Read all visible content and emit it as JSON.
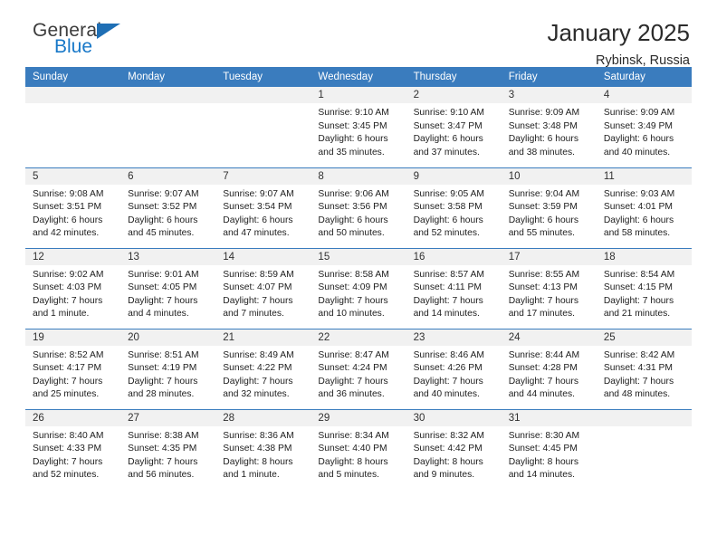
{
  "brand": {
    "name_top": "General",
    "name_bottom": "Blue",
    "triangle_color": "#1f6fb5",
    "blue_color": "#1878c8"
  },
  "header": {
    "title": "January 2025",
    "location": "Rybinsk, Russia"
  },
  "theme": {
    "header_row_bg": "#3a7cbe",
    "daynum_bg": "#f1f1f1",
    "row_rule": "#3a7cbe"
  },
  "calendar": {
    "weekday_headers": [
      "Sunday",
      "Monday",
      "Tuesday",
      "Wednesday",
      "Thursday",
      "Friday",
      "Saturday"
    ],
    "weeks": [
      [
        {
          "day": "",
          "empty": true
        },
        {
          "day": "",
          "empty": true
        },
        {
          "day": "",
          "empty": true
        },
        {
          "day": "1",
          "sunrise": "Sunrise: 9:10 AM",
          "sunset": "Sunset: 3:45 PM",
          "daylight1": "Daylight: 6 hours",
          "daylight2": "and 35 minutes."
        },
        {
          "day": "2",
          "sunrise": "Sunrise: 9:10 AM",
          "sunset": "Sunset: 3:47 PM",
          "daylight1": "Daylight: 6 hours",
          "daylight2": "and 37 minutes."
        },
        {
          "day": "3",
          "sunrise": "Sunrise: 9:09 AM",
          "sunset": "Sunset: 3:48 PM",
          "daylight1": "Daylight: 6 hours",
          "daylight2": "and 38 minutes."
        },
        {
          "day": "4",
          "sunrise": "Sunrise: 9:09 AM",
          "sunset": "Sunset: 3:49 PM",
          "daylight1": "Daylight: 6 hours",
          "daylight2": "and 40 minutes."
        }
      ],
      [
        {
          "day": "5",
          "sunrise": "Sunrise: 9:08 AM",
          "sunset": "Sunset: 3:51 PM",
          "daylight1": "Daylight: 6 hours",
          "daylight2": "and 42 minutes."
        },
        {
          "day": "6",
          "sunrise": "Sunrise: 9:07 AM",
          "sunset": "Sunset: 3:52 PM",
          "daylight1": "Daylight: 6 hours",
          "daylight2": "and 45 minutes."
        },
        {
          "day": "7",
          "sunrise": "Sunrise: 9:07 AM",
          "sunset": "Sunset: 3:54 PM",
          "daylight1": "Daylight: 6 hours",
          "daylight2": "and 47 minutes."
        },
        {
          "day": "8",
          "sunrise": "Sunrise: 9:06 AM",
          "sunset": "Sunset: 3:56 PM",
          "daylight1": "Daylight: 6 hours",
          "daylight2": "and 50 minutes."
        },
        {
          "day": "9",
          "sunrise": "Sunrise: 9:05 AM",
          "sunset": "Sunset: 3:58 PM",
          "daylight1": "Daylight: 6 hours",
          "daylight2": "and 52 minutes."
        },
        {
          "day": "10",
          "sunrise": "Sunrise: 9:04 AM",
          "sunset": "Sunset: 3:59 PM",
          "daylight1": "Daylight: 6 hours",
          "daylight2": "and 55 minutes."
        },
        {
          "day": "11",
          "sunrise": "Sunrise: 9:03 AM",
          "sunset": "Sunset: 4:01 PM",
          "daylight1": "Daylight: 6 hours",
          "daylight2": "and 58 minutes."
        }
      ],
      [
        {
          "day": "12",
          "sunrise": "Sunrise: 9:02 AM",
          "sunset": "Sunset: 4:03 PM",
          "daylight1": "Daylight: 7 hours",
          "daylight2": "and 1 minute."
        },
        {
          "day": "13",
          "sunrise": "Sunrise: 9:01 AM",
          "sunset": "Sunset: 4:05 PM",
          "daylight1": "Daylight: 7 hours",
          "daylight2": "and 4 minutes."
        },
        {
          "day": "14",
          "sunrise": "Sunrise: 8:59 AM",
          "sunset": "Sunset: 4:07 PM",
          "daylight1": "Daylight: 7 hours",
          "daylight2": "and 7 minutes."
        },
        {
          "day": "15",
          "sunrise": "Sunrise: 8:58 AM",
          "sunset": "Sunset: 4:09 PM",
          "daylight1": "Daylight: 7 hours",
          "daylight2": "and 10 minutes."
        },
        {
          "day": "16",
          "sunrise": "Sunrise: 8:57 AM",
          "sunset": "Sunset: 4:11 PM",
          "daylight1": "Daylight: 7 hours",
          "daylight2": "and 14 minutes."
        },
        {
          "day": "17",
          "sunrise": "Sunrise: 8:55 AM",
          "sunset": "Sunset: 4:13 PM",
          "daylight1": "Daylight: 7 hours",
          "daylight2": "and 17 minutes."
        },
        {
          "day": "18",
          "sunrise": "Sunrise: 8:54 AM",
          "sunset": "Sunset: 4:15 PM",
          "daylight1": "Daylight: 7 hours",
          "daylight2": "and 21 minutes."
        }
      ],
      [
        {
          "day": "19",
          "sunrise": "Sunrise: 8:52 AM",
          "sunset": "Sunset: 4:17 PM",
          "daylight1": "Daylight: 7 hours",
          "daylight2": "and 25 minutes."
        },
        {
          "day": "20",
          "sunrise": "Sunrise: 8:51 AM",
          "sunset": "Sunset: 4:19 PM",
          "daylight1": "Daylight: 7 hours",
          "daylight2": "and 28 minutes."
        },
        {
          "day": "21",
          "sunrise": "Sunrise: 8:49 AM",
          "sunset": "Sunset: 4:22 PM",
          "daylight1": "Daylight: 7 hours",
          "daylight2": "and 32 minutes."
        },
        {
          "day": "22",
          "sunrise": "Sunrise: 8:47 AM",
          "sunset": "Sunset: 4:24 PM",
          "daylight1": "Daylight: 7 hours",
          "daylight2": "and 36 minutes."
        },
        {
          "day": "23",
          "sunrise": "Sunrise: 8:46 AM",
          "sunset": "Sunset: 4:26 PM",
          "daylight1": "Daylight: 7 hours",
          "daylight2": "and 40 minutes."
        },
        {
          "day": "24",
          "sunrise": "Sunrise: 8:44 AM",
          "sunset": "Sunset: 4:28 PM",
          "daylight1": "Daylight: 7 hours",
          "daylight2": "and 44 minutes."
        },
        {
          "day": "25",
          "sunrise": "Sunrise: 8:42 AM",
          "sunset": "Sunset: 4:31 PM",
          "daylight1": "Daylight: 7 hours",
          "daylight2": "and 48 minutes."
        }
      ],
      [
        {
          "day": "26",
          "sunrise": "Sunrise: 8:40 AM",
          "sunset": "Sunset: 4:33 PM",
          "daylight1": "Daylight: 7 hours",
          "daylight2": "and 52 minutes."
        },
        {
          "day": "27",
          "sunrise": "Sunrise: 8:38 AM",
          "sunset": "Sunset: 4:35 PM",
          "daylight1": "Daylight: 7 hours",
          "daylight2": "and 56 minutes."
        },
        {
          "day": "28",
          "sunrise": "Sunrise: 8:36 AM",
          "sunset": "Sunset: 4:38 PM",
          "daylight1": "Daylight: 8 hours",
          "daylight2": "and 1 minute."
        },
        {
          "day": "29",
          "sunrise": "Sunrise: 8:34 AM",
          "sunset": "Sunset: 4:40 PM",
          "daylight1": "Daylight: 8 hours",
          "daylight2": "and 5 minutes."
        },
        {
          "day": "30",
          "sunrise": "Sunrise: 8:32 AM",
          "sunset": "Sunset: 4:42 PM",
          "daylight1": "Daylight: 8 hours",
          "daylight2": "and 9 minutes."
        },
        {
          "day": "31",
          "sunrise": "Sunrise: 8:30 AM",
          "sunset": "Sunset: 4:45 PM",
          "daylight1": "Daylight: 8 hours",
          "daylight2": "and 14 minutes."
        },
        {
          "day": "",
          "empty": true
        }
      ]
    ]
  }
}
